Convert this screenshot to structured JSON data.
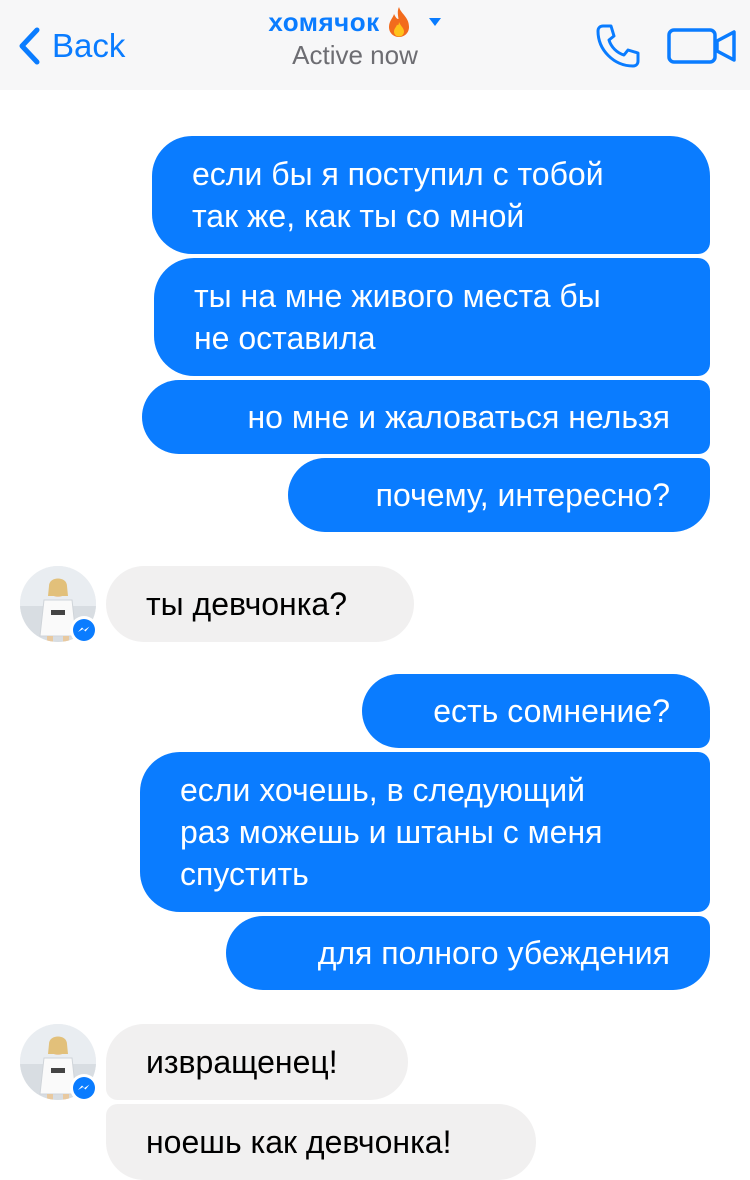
{
  "header": {
    "back_label": "Back",
    "title": "хомячок",
    "status": "Active now",
    "accent_color": "#0a7cff",
    "icons": [
      "chevron-left-icon",
      "fire-emoji-icon",
      "caret-down-icon",
      "phone-icon",
      "video-camera-icon"
    ]
  },
  "messages": [
    {
      "from": "me",
      "text": "если бы я поступил с тобой\nтак же, как ты со мной"
    },
    {
      "from": "me",
      "text": "ты на мне живого места бы\nне оставила"
    },
    {
      "from": "me",
      "text": "но мне и жаловаться нельзя"
    },
    {
      "from": "me",
      "text": "почему, интересно?"
    },
    {
      "from": "them",
      "text": "ты девчонка?"
    },
    {
      "from": "me",
      "text": "есть сомнение?"
    },
    {
      "from": "me",
      "text": "если хочешь, в следующий\nраз можешь и штаны с меня\nспустить"
    },
    {
      "from": "me",
      "text": "для полного убеждения"
    },
    {
      "from": "them",
      "text": "извращенец!"
    },
    {
      "from": "them",
      "text": "ноешь как девчонка!"
    }
  ],
  "colors": {
    "outgoing_bubble": "#0a7cff",
    "incoming_bubble": "#f1f0f0"
  }
}
